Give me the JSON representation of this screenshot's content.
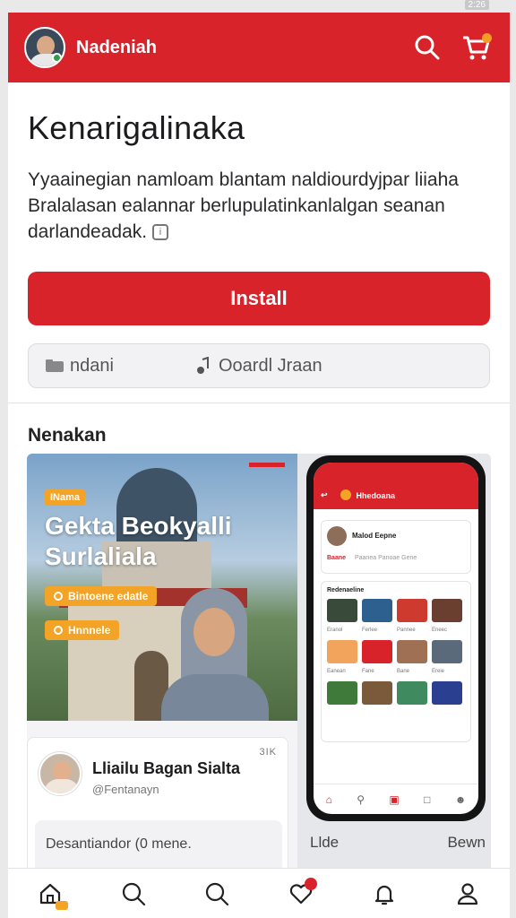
{
  "status_bar": {
    "text": "2:26"
  },
  "header": {
    "app_name": "Nadeniah"
  },
  "main": {
    "title": "Kenarigalinaka",
    "description": "Yyaainegian namloam blantam naldiourdyjpar liiaha Bralalasan ealannar berlupulatinkanlalgan seanan darlandeadak.",
    "install_label": "Install",
    "segments": [
      "ndani",
      "Ooardl Jraan"
    ],
    "section_title": "Nenakan"
  },
  "promo": {
    "badge": "INama",
    "title_line1": "Gekta Beokyalli",
    "title_line2": "Surlaliala",
    "pill1": "Bintoene edatle",
    "pill2": "Hnnnele",
    "phone": {
      "header_title": "Hhedoana",
      "card_name": "Malod Eepne",
      "card_tabs": [
        "Baane",
        "Paanea",
        "Panoae",
        "Gene"
      ],
      "grid_title": "Redenaeline",
      "tile_colors": [
        "#3a4a3a",
        "#2d5f8f",
        "#cf3a2f",
        "#6a3f2f",
        "#f2a35c",
        "#d8232b",
        "#a07055",
        "#5a6a7a",
        "#3f7a3a",
        "#7a5a3a",
        "#3f8a5f",
        "#2a3f8f"
      ],
      "tile_labels": [
        "Eranol",
        "Ferlee",
        "Pannee",
        "Eneec",
        "Eanean",
        "Fane",
        "Bane",
        "Ereie"
      ]
    },
    "right_footer": [
      "Llde",
      "Bewn"
    ]
  },
  "user_card": {
    "name": "Lliailu Bagan Sialta",
    "handle": "@Fentanayn",
    "count": "3IK",
    "comment": "Desantiandor (0 mene."
  },
  "colors": {
    "brand_red": "#d8232b",
    "accent_orange": "#f3a326"
  }
}
